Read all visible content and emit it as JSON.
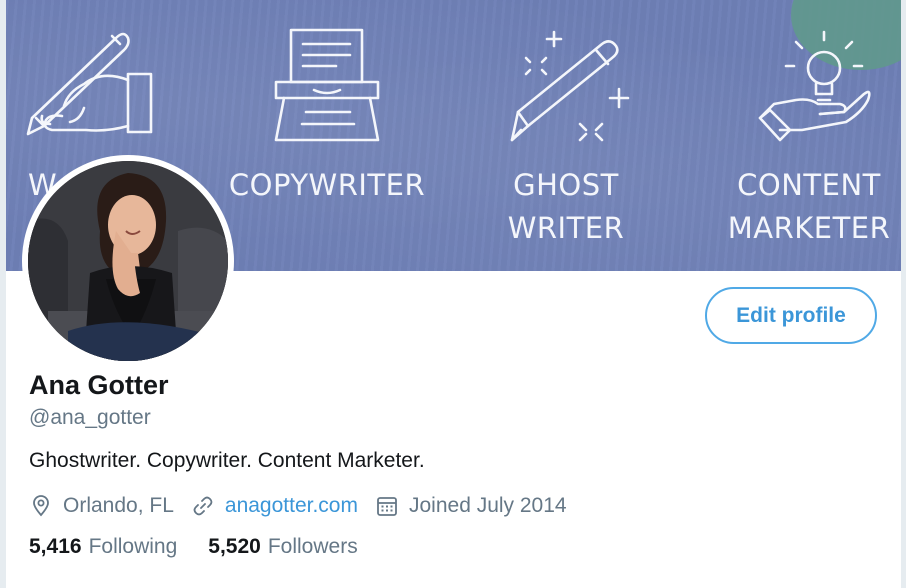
{
  "banner": {
    "labels": {
      "writer": "W",
      "copywriter": "COPYWRITER",
      "ghost_line1": "GHOST",
      "ghost_line2": "WRITER",
      "content_line1": "CONTENT",
      "content_line2": "MARKETER"
    },
    "bg_color": "#6e7fb6",
    "icons": [
      "hand-writing-icon",
      "typewriter-icon",
      "pencil-sparkle-icon",
      "hand-lightbulb-icon"
    ]
  },
  "profile": {
    "name": "Ana Gotter",
    "handle": "@ana_gotter",
    "bio": "Ghostwriter. Copywriter. Content Marketer.",
    "location": "Orlando, FL",
    "website": "anagotter.com",
    "joined": "Joined July 2014",
    "following_count": "5,416",
    "following_label": "Following",
    "followers_count": "5,520",
    "followers_label": "Followers"
  },
  "actions": {
    "edit_profile": "Edit profile"
  },
  "colors": {
    "accent": "#3b96d8",
    "muted_text": "#657786",
    "primary_text": "#14171a"
  }
}
